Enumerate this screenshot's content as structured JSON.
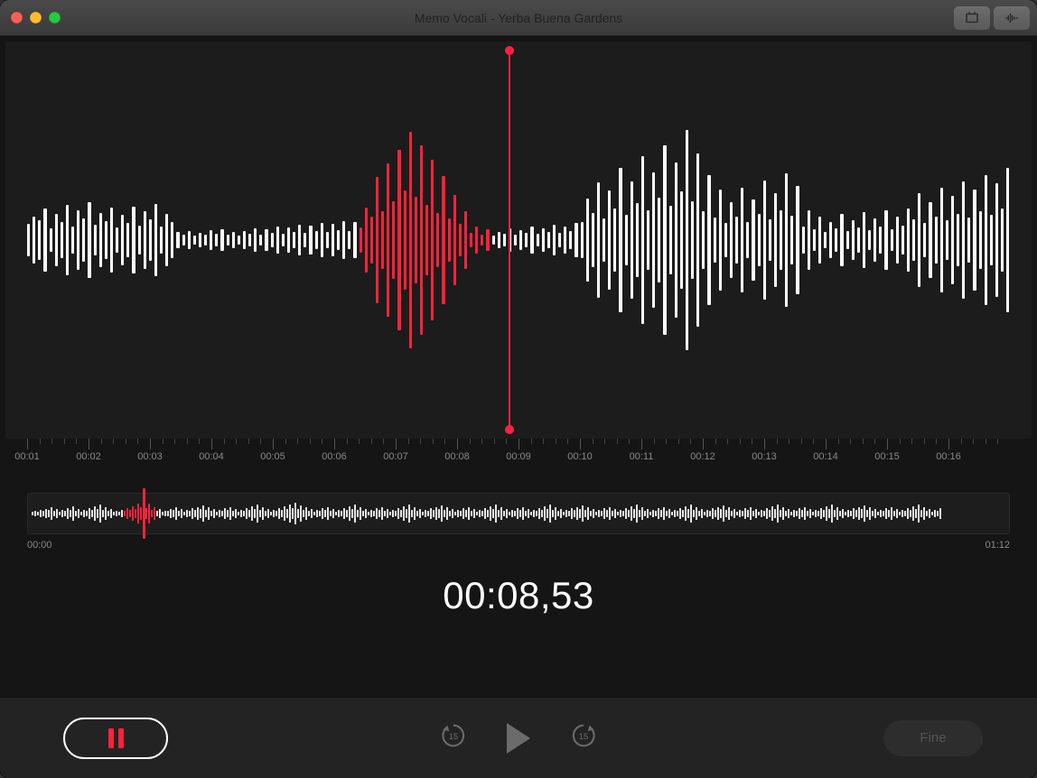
{
  "window": {
    "title": "Memo Vocali - Yerba Buena Gardens"
  },
  "icons": {
    "trim": "trim-icon",
    "enhance": "enhance-icon"
  },
  "ruler": {
    "labels": [
      "00:01",
      "00:02",
      "00:03",
      "00:04",
      "00:05",
      "00:06",
      "00:07",
      "00:08",
      "00:09",
      "00:10",
      "00:11",
      "00:12",
      "00:13",
      "00:14",
      "00:15",
      "00:16"
    ]
  },
  "overview": {
    "start": "00:00",
    "end": "01:12",
    "playhead_fraction": 0.117
  },
  "readout": {
    "time": "00:08,53"
  },
  "controls": {
    "record_pause": "pause",
    "skip_back_label": "15",
    "skip_fwd_label": "15",
    "done_label": "Fine"
  },
  "waveform_main": {
    "playhead_fraction": 0.49,
    "bars": [
      36,
      52,
      44,
      70,
      26,
      58,
      40,
      78,
      30,
      66,
      48,
      84,
      34,
      60,
      42,
      72,
      28,
      56,
      38,
      74,
      32,
      64,
      46,
      80,
      30,
      58,
      40,
      18,
      12,
      20,
      10,
      16,
      12,
      22,
      14,
      24,
      12,
      18,
      10,
      20,
      14,
      26,
      12,
      24,
      16,
      30,
      14,
      28,
      18,
      34,
      16,
      32,
      20,
      38,
      18,
      36,
      22,
      42,
      20,
      40,
      28,
      72,
      52,
      140,
      64,
      170,
      86,
      200,
      110,
      240,
      96,
      210,
      78,
      178,
      60,
      142,
      48,
      100,
      36,
      64,
      16,
      30,
      12,
      24,
      10,
      18,
      14,
      26,
      12,
      22,
      16,
      30,
      14,
      26,
      18,
      34,
      16,
      30,
      20,
      38,
      40,
      92,
      60,
      128,
      48,
      110,
      70,
      160,
      56,
      130,
      82,
      186,
      66,
      150,
      94,
      210,
      76,
      172,
      108,
      244,
      86,
      192,
      64,
      144,
      50,
      112,
      38,
      84,
      52,
      116,
      40,
      90,
      58,
      132,
      46,
      104,
      66,
      148,
      54,
      120,
      30,
      66,
      24,
      52,
      18,
      40,
      26,
      58,
      20,
      44,
      28,
      62,
      22,
      48,
      30,
      66,
      24,
      52,
      32,
      70,
      46,
      104,
      38,
      84,
      52,
      116,
      44,
      98,
      58,
      130,
      50,
      112,
      64,
      144,
      56,
      126,
      70,
      160
    ],
    "red_start": 60,
    "red_end": 84
  },
  "waveform_overview": {
    "bars": [
      4,
      6,
      4,
      8,
      6,
      10,
      8,
      14,
      6,
      10,
      4,
      8,
      6,
      12,
      8,
      16,
      6,
      10,
      4,
      8,
      6,
      12,
      8,
      16,
      10,
      20,
      8,
      14,
      6,
      10,
      4,
      6,
      4,
      8,
      6,
      12,
      8,
      16,
      10,
      22,
      14,
      28,
      12,
      22,
      8,
      14,
      6,
      10,
      4,
      6,
      6,
      10,
      8,
      14,
      6,
      10,
      4,
      8,
      6,
      12,
      8,
      14,
      10,
      18,
      8,
      14,
      6,
      10,
      4,
      8,
      6,
      12,
      8,
      14,
      6,
      10,
      4,
      8,
      6,
      12,
      8,
      16,
      10,
      20,
      8,
      14,
      6,
      10,
      4,
      8,
      6,
      12,
      8,
      16,
      10,
      20,
      12,
      24,
      10,
      18,
      8,
      14,
      6,
      10,
      4,
      8,
      6,
      12,
      8,
      14,
      6,
      10,
      4,
      8,
      6,
      12,
      8,
      16,
      10,
      20,
      8,
      14,
      6,
      10,
      4,
      8,
      6,
      12,
      8,
      14,
      6,
      10,
      4,
      8,
      6,
      12,
      8,
      16,
      10,
      20,
      8,
      14,
      6,
      10,
      4,
      8,
      6,
      12,
      8,
      14,
      10,
      18,
      8,
      14,
      6,
      10,
      4,
      8,
      6,
      12,
      8,
      14,
      6,
      10,
      4,
      8,
      6,
      12,
      8,
      16,
      10,
      20,
      8,
      14,
      6,
      10,
      4,
      8,
      6,
      12,
      8,
      14,
      6,
      10,
      4,
      8,
      6,
      12,
      8,
      16,
      10,
      20,
      8,
      14,
      6,
      10,
      4,
      8,
      6,
      12,
      8,
      14,
      10,
      18,
      8,
      14,
      6,
      10,
      4,
      8,
      6,
      12,
      8,
      14,
      6,
      10,
      4,
      8,
      6,
      12,
      8,
      16,
      10,
      20,
      8,
      14,
      6,
      10,
      4,
      8,
      6,
      12,
      8,
      14,
      6,
      10,
      4,
      8,
      6,
      12,
      8,
      16,
      10,
      20,
      8,
      14,
      6,
      10,
      4,
      8,
      6,
      12,
      8,
      14,
      10,
      18,
      8,
      14,
      6,
      10,
      4,
      8,
      6,
      12,
      8,
      14,
      6,
      10,
      4,
      8,
      6,
      12,
      8,
      16,
      10,
      20,
      8,
      14,
      6,
      10,
      4,
      8,
      6,
      12,
      8,
      14,
      6,
      10,
      4,
      8,
      6,
      12,
      8,
      16,
      10,
      20,
      8,
      14,
      6,
      10,
      4,
      8,
      6,
      12,
      8,
      14,
      10,
      18,
      8,
      14,
      6,
      10,
      4,
      8,
      6,
      12,
      8,
      14,
      6,
      10,
      4,
      8,
      6,
      12,
      8,
      16,
      10,
      20,
      8,
      14,
      6,
      10,
      4,
      8,
      6,
      12
    ],
    "red_start": 34,
    "red_end": 46
  }
}
